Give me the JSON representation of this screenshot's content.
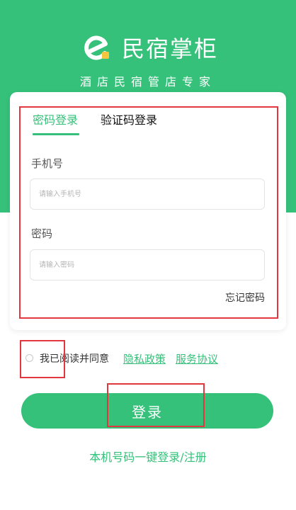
{
  "header": {
    "brand_name": "民宿掌柜",
    "slogan": "酒店民宿管店专家",
    "logo_icon": "e-logo-icon"
  },
  "login_form": {
    "tabs": [
      {
        "label": "密码登录",
        "active": true
      },
      {
        "label": "验证码登录",
        "active": false
      }
    ],
    "phone": {
      "label": "手机号",
      "placeholder": "请输入手机号",
      "value": ""
    },
    "password": {
      "label": "密码",
      "placeholder": "请输入密码",
      "value": ""
    },
    "forgot_password": "忘记密码"
  },
  "agreement": {
    "checked": false,
    "text": "我已阅读并同意",
    "privacy_link": "隐私政策",
    "service_link": "服务协议"
  },
  "login_button": "登录",
  "one_key_login": "本机号码一键登录/注册",
  "colors": {
    "primary": "#35c17a",
    "logo_accent": "#f5c542",
    "highlight": "#e2373f"
  }
}
